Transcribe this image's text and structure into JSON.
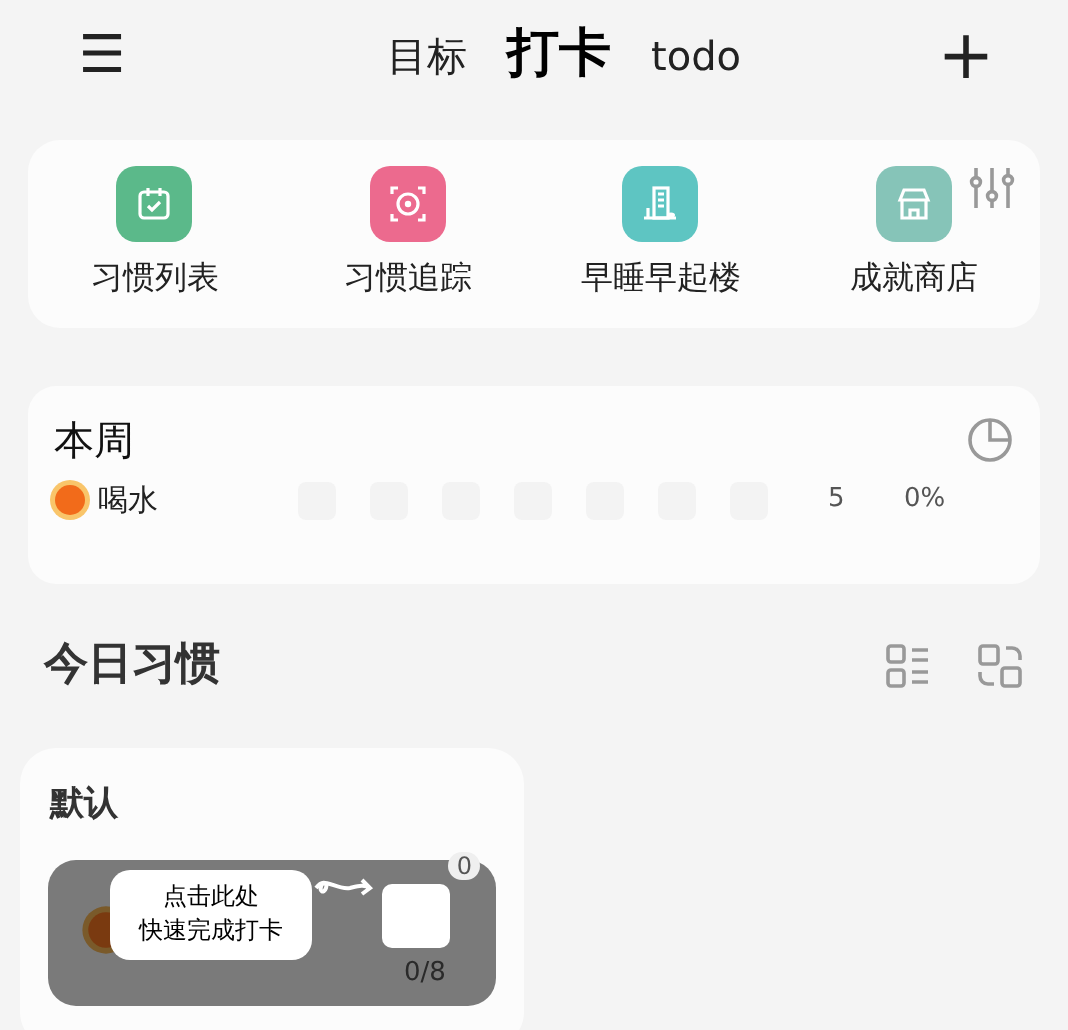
{
  "header": {
    "menu": "☰",
    "add": "+",
    "tabs": [
      {
        "label": "目标",
        "selected": false
      },
      {
        "label": "打卡",
        "selected": true
      },
      {
        "label": "todo",
        "selected": false
      }
    ]
  },
  "shortcuts": [
    {
      "label": "习惯列表",
      "color": "#5bb98a",
      "kind": "calendar"
    },
    {
      "label": "习惯追踪",
      "color": "#ec6a8e",
      "kind": "target"
    },
    {
      "label": "早睡早起楼",
      "color": "#5ec5c2",
      "kind": "building"
    },
    {
      "label": "成就商店",
      "color": "#86c4b8",
      "kind": "shop"
    }
  ],
  "week": {
    "title": "本周",
    "habits": [
      {
        "name": "喝水",
        "days": [
          {
            "done": false
          },
          {
            "done": false
          },
          {
            "done": false
          },
          {
            "done": false
          },
          {
            "done": false
          },
          {
            "done": false
          },
          {
            "done": false
          }
        ],
        "count": "5",
        "percent": "0%"
      }
    ]
  },
  "today": {
    "title": "今日习惯",
    "groups": [
      {
        "title": "默认",
        "habit": {
          "streak": "0",
          "progress": "0/8",
          "done": false
        },
        "tip": {
          "line1": "点击此处",
          "line2": "快速完成打卡"
        }
      }
    ]
  }
}
